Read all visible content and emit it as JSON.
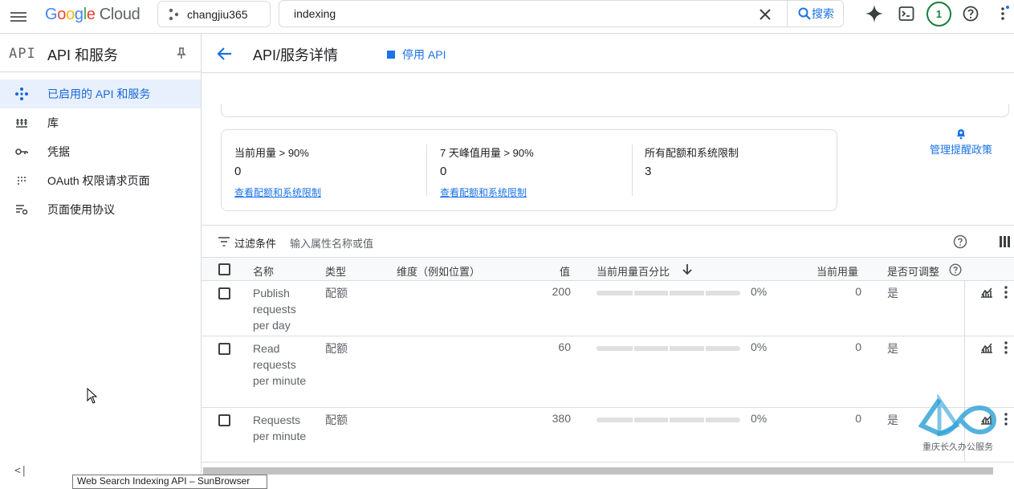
{
  "header": {
    "logo_google": [
      "G",
      "o",
      "o",
      "g",
      "l",
      "e"
    ],
    "logo_cloud": "Cloud",
    "project": "changjiu365",
    "search_value": "indexing",
    "search_button": "搜索",
    "notification_count": "1"
  },
  "sidebar": {
    "api_logo": "API",
    "title": "API 和服务",
    "items": [
      {
        "label": "已启用的 API 和服务",
        "icon": "api-diamond-icon",
        "active": true
      },
      {
        "label": "库",
        "icon": "library-icon"
      },
      {
        "label": "凭据",
        "icon": "key-icon"
      },
      {
        "label": "OAuth 权限请求页面",
        "icon": "oauth-dots-icon"
      },
      {
        "label": "页面使用协议",
        "icon": "settings-list-icon"
      }
    ],
    "collapse": "<|"
  },
  "main": {
    "title": "API/服务详情",
    "disable_label": "停用 API",
    "quota_cards": [
      {
        "title": "当前用量 > 90%",
        "value": "0",
        "link": "查看配额和系统限制"
      },
      {
        "title": "7 天峰值用量 > 90%",
        "value": "0",
        "link": "查看配额和系统限制"
      },
      {
        "title": "所有配额和系统限制",
        "value": "3",
        "link": ""
      }
    ],
    "alert_policy": "管理提醒政策",
    "filter_label": "过滤条件",
    "filter_placeholder": "输入属性名称或值"
  },
  "table": {
    "headers": {
      "name": "名称",
      "type": "类型",
      "dimension": "维度（例如位置）",
      "value": "值",
      "pct": "当前用量百分比",
      "current": "当前用量",
      "adjustable": "是否可调整"
    },
    "rows": [
      {
        "name": "Publish requests per day",
        "type": "配额",
        "value": "200",
        "pct": "0%",
        "usage_fraction": 0,
        "current": "0",
        "adjustable": "是"
      },
      {
        "name": "Read requests per minute",
        "type": "配额",
        "value": "60",
        "pct": "0%",
        "usage_fraction": 0,
        "current": "0",
        "adjustable": "是"
      },
      {
        "name": "Requests per minute",
        "type": "配额",
        "value": "380",
        "pct": "0%",
        "usage_fraction": 0,
        "current": "0",
        "adjustable": "是"
      }
    ]
  },
  "tooltip": "Web Search Indexing API – SunBrowser",
  "watermark": "重庆长久办公服务",
  "colors": {
    "accent": "#1a73e8",
    "active_bg": "#e8f0fe",
    "border": "#dadce0"
  }
}
